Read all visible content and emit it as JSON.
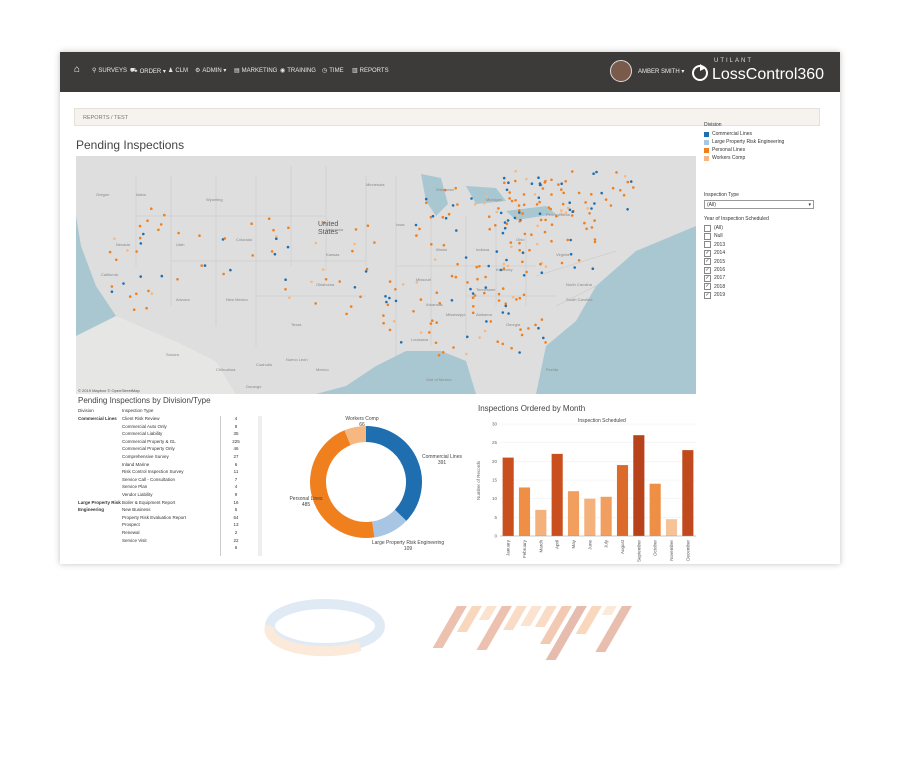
{
  "nav": {
    "items": [
      {
        "icon": "search-icon",
        "glyph": "⚲",
        "label": "SURVEYS"
      },
      {
        "icon": "cart-icon",
        "glyph": "⛟",
        "label": "ORDER ▾"
      },
      {
        "icon": "users-icon",
        "glyph": "♟",
        "label": "CLM"
      },
      {
        "icon": "gear-icon",
        "glyph": "⚙",
        "label": "ADMIN ▾"
      },
      {
        "icon": "document-icon",
        "glyph": "▤",
        "label": "MARKETING"
      },
      {
        "icon": "training-icon",
        "glyph": "◉",
        "label": "TRAINING"
      },
      {
        "icon": "clock-icon",
        "glyph": "◷",
        "label": "TIME"
      },
      {
        "icon": "chart-icon",
        "glyph": "▥",
        "label": "REPORTS"
      }
    ],
    "user_name": "AMBER SMITH ▾",
    "brand_tag": "UTILANT",
    "brand_name": "LossControl360"
  },
  "breadcrumb": "REPORTS  /  TEST",
  "page_title": "Pending Inspections",
  "map": {
    "credit": "© 2019 Mapbox  © OpenStreetMap",
    "labels": [
      {
        "text": "United",
        "kind": "country"
      },
      {
        "text": "States",
        "kind": "country"
      },
      {
        "text": "Oregon"
      },
      {
        "text": "Idaho"
      },
      {
        "text": "Wyoming"
      },
      {
        "text": "Nevada"
      },
      {
        "text": "Utah"
      },
      {
        "text": "Colorado"
      },
      {
        "text": "California"
      },
      {
        "text": "Arizona"
      },
      {
        "text": "New Mexico"
      },
      {
        "text": "Texas"
      },
      {
        "text": "Oklahoma"
      },
      {
        "text": "Kansas"
      },
      {
        "text": "Nebraska"
      },
      {
        "text": "Missouri"
      },
      {
        "text": "Illinois"
      },
      {
        "text": "Iowa"
      },
      {
        "text": "Arkansas"
      },
      {
        "text": "Mississippi"
      },
      {
        "text": "Alabama"
      },
      {
        "text": "Georgia"
      },
      {
        "text": "Tennessee"
      },
      {
        "text": "Kentucky"
      },
      {
        "text": "Indiana"
      },
      {
        "text": "Ohio"
      },
      {
        "text": "Pennsylvania"
      },
      {
        "text": "Virginia"
      },
      {
        "text": "North Carolina"
      },
      {
        "text": "South Carolina"
      },
      {
        "text": "Florida"
      },
      {
        "text": "Michigan"
      },
      {
        "text": "Wisconsin"
      },
      {
        "text": "Minnesota"
      },
      {
        "text": "Louisiana"
      },
      {
        "text": "Mexico"
      },
      {
        "text": "Gulf of Mexico"
      },
      {
        "text": "Chihuahua"
      },
      {
        "text": "Coahuila"
      },
      {
        "text": "Nuevo León"
      },
      {
        "text": "Sonora"
      },
      {
        "text": "Durango"
      }
    ]
  },
  "table": {
    "title": "Pending Inspections by Division/Type",
    "col_division": "Division",
    "col_type": "Inspection Type",
    "rows": [
      {
        "division": "Commercial Lines",
        "type": "Client Risk Review",
        "count": "4"
      },
      {
        "division": "",
        "type": "Commercial Auto Only",
        "count": "8"
      },
      {
        "division": "",
        "type": "Commercial Liability",
        "count": "35"
      },
      {
        "division": "",
        "type": "Commercial Property & GL",
        "count": "225"
      },
      {
        "division": "",
        "type": "Commercial Property Only",
        "count": "46"
      },
      {
        "division": "",
        "type": "Comprehensive Survey",
        "count": "27"
      },
      {
        "division": "",
        "type": "Inland Marine",
        "count": "6"
      },
      {
        "division": "",
        "type": "Risk Control Inspection Survey",
        "count": "11"
      },
      {
        "division": "",
        "type": "Service Call - Consultation",
        "count": "7"
      },
      {
        "division": "",
        "type": "Service Plan",
        "count": "4"
      },
      {
        "division": "",
        "type": "Vendor Liability",
        "count": "9"
      },
      {
        "division": "Large Property Risk",
        "type": "Boiler & Equipment Report",
        "count": "16"
      },
      {
        "division": "Engineering",
        "type": "New Business",
        "count": "5"
      },
      {
        "division": "",
        "type": "Property Risk Evaluation Report",
        "count": "64"
      },
      {
        "division": "",
        "type": "Prospect",
        "count": "13"
      },
      {
        "division": "",
        "type": "Renewal",
        "count": "2"
      },
      {
        "division": "",
        "type": "Service Visit",
        "count": "22"
      },
      {
        "division": "",
        "type": "",
        "count": "6"
      }
    ]
  },
  "donut": {
    "slices": [
      {
        "name": "Commercial Lines",
        "value": 391,
        "color": "#1f6fb0"
      },
      {
        "name": "Large Property Risk Engineering",
        "value": 109,
        "color": "#a8c6e4"
      },
      {
        "name": "Personal Lines",
        "value": 485,
        "color": "#f07f1e"
      },
      {
        "name": "Workers Comp",
        "value": 66,
        "color": "#f6b880"
      }
    ],
    "labels": {
      "workers_comp_name": "Workers Comp",
      "workers_comp_value": "66",
      "commercial_name": "Commercial Lines",
      "commercial_value": "391",
      "personal_name": "Personal Lines",
      "personal_value": "485",
      "large_property_name": "Large Property Risk Engineering",
      "large_property_value": "109"
    }
  },
  "chart_data": {
    "type": "bar",
    "title": "Inspections Ordered by Month",
    "subtitle": "Inspection Scheduled",
    "ylabel": "Number of Records",
    "xlabel": "",
    "ylim": [
      0,
      30
    ],
    "yticks": [
      0,
      5,
      10,
      15,
      20,
      25,
      30
    ],
    "categories": [
      "January",
      "February",
      "March",
      "April",
      "May",
      "June",
      "July",
      "August",
      "September",
      "October",
      "November",
      "December"
    ],
    "values": [
      21,
      13,
      7,
      22,
      12,
      10,
      10.5,
      19,
      27,
      14,
      4.5,
      23
    ],
    "colors": [
      "#c94f1f",
      "#ee8f45",
      "#f4b17c",
      "#c94f1f",
      "#f19e5e",
      "#f4b17c",
      "#f19e5e",
      "#dc6a2a",
      "#b8421a",
      "#ee8f45",
      "#f6c297",
      "#c04a1d"
    ]
  },
  "filters": {
    "division_title": "Division",
    "division_items": [
      {
        "label": "Commercial Lines",
        "color": "#1f6fb0"
      },
      {
        "label": "Large Property Risk Engineering",
        "color": "#a8c6e4"
      },
      {
        "label": "Personal Lines",
        "color": "#f07f1e"
      },
      {
        "label": "Workers Comp",
        "color": "#f6b880"
      }
    ],
    "type_title": "Inspection Type",
    "type_value": "(All)",
    "year_title": "Year of Inspection Scheduled",
    "year_items": [
      {
        "label": "(All)",
        "checked": false
      },
      {
        "label": "Null",
        "checked": false
      },
      {
        "label": "2013",
        "checked": false
      },
      {
        "label": "2014",
        "checked": true
      },
      {
        "label": "2015",
        "checked": true
      },
      {
        "label": "2016",
        "checked": true
      },
      {
        "label": "2017",
        "checked": true
      },
      {
        "label": "2018",
        "checked": true
      },
      {
        "label": "2019",
        "checked": true
      }
    ]
  }
}
